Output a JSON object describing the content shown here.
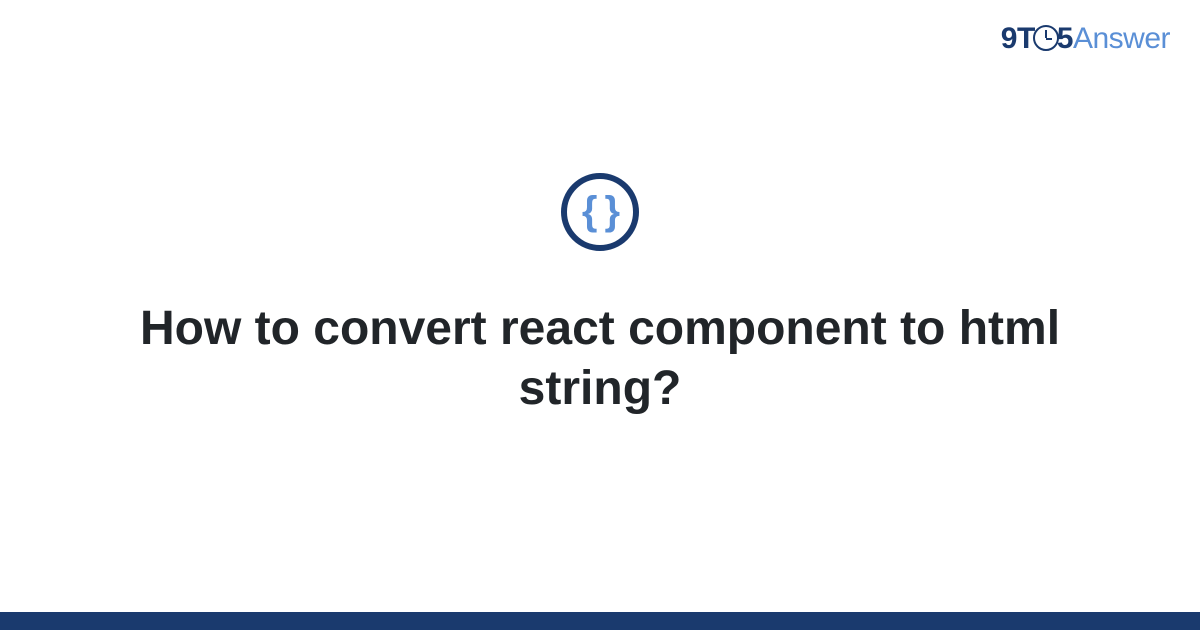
{
  "logo": {
    "part1": "9",
    "part2": "T",
    "part3": "5",
    "part4": "Answer"
  },
  "icon": {
    "name": "code-braces-icon",
    "glyph": "{ }"
  },
  "title": "How to convert react component to html string?",
  "colors": {
    "brand_dark": "#1a3a6e",
    "brand_light": "#5a8fd6"
  }
}
